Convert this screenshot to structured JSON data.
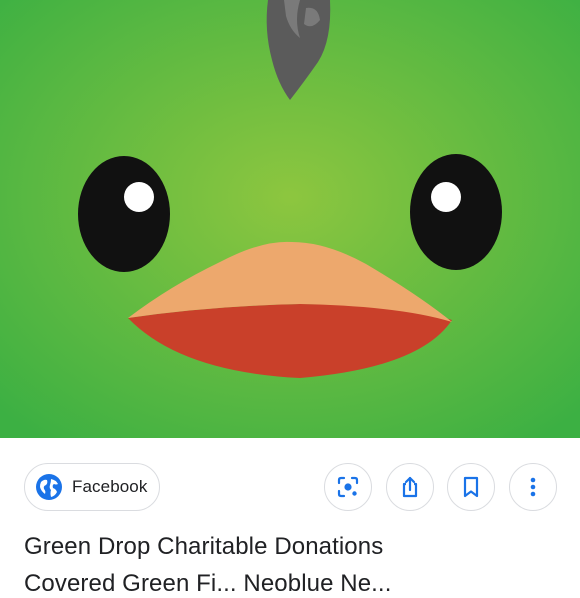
{
  "image": {
    "description_icon": "duck-face-image",
    "colors": {
      "green_center": "#8dc63f",
      "green_edge": "#3cb043",
      "beak_top": "#eda86d",
      "beak_bottom": "#c9402a",
      "eye": "#111111",
      "crest": "#5b5b5b"
    }
  },
  "source": {
    "icon": "globe-icon",
    "label": "Facebook"
  },
  "actions": [
    {
      "name": "lens-button",
      "icon": "lens-icon"
    },
    {
      "name": "share-button",
      "icon": "share-icon"
    },
    {
      "name": "save-button",
      "icon": "bookmark-icon"
    },
    {
      "name": "more-button",
      "icon": "more-vert-icon"
    }
  ],
  "result": {
    "title": "Green Drop Charitable Donations",
    "subtitle": "Covered Green Fi... Neoblue Ne..."
  },
  "accent": "#1a73e8"
}
